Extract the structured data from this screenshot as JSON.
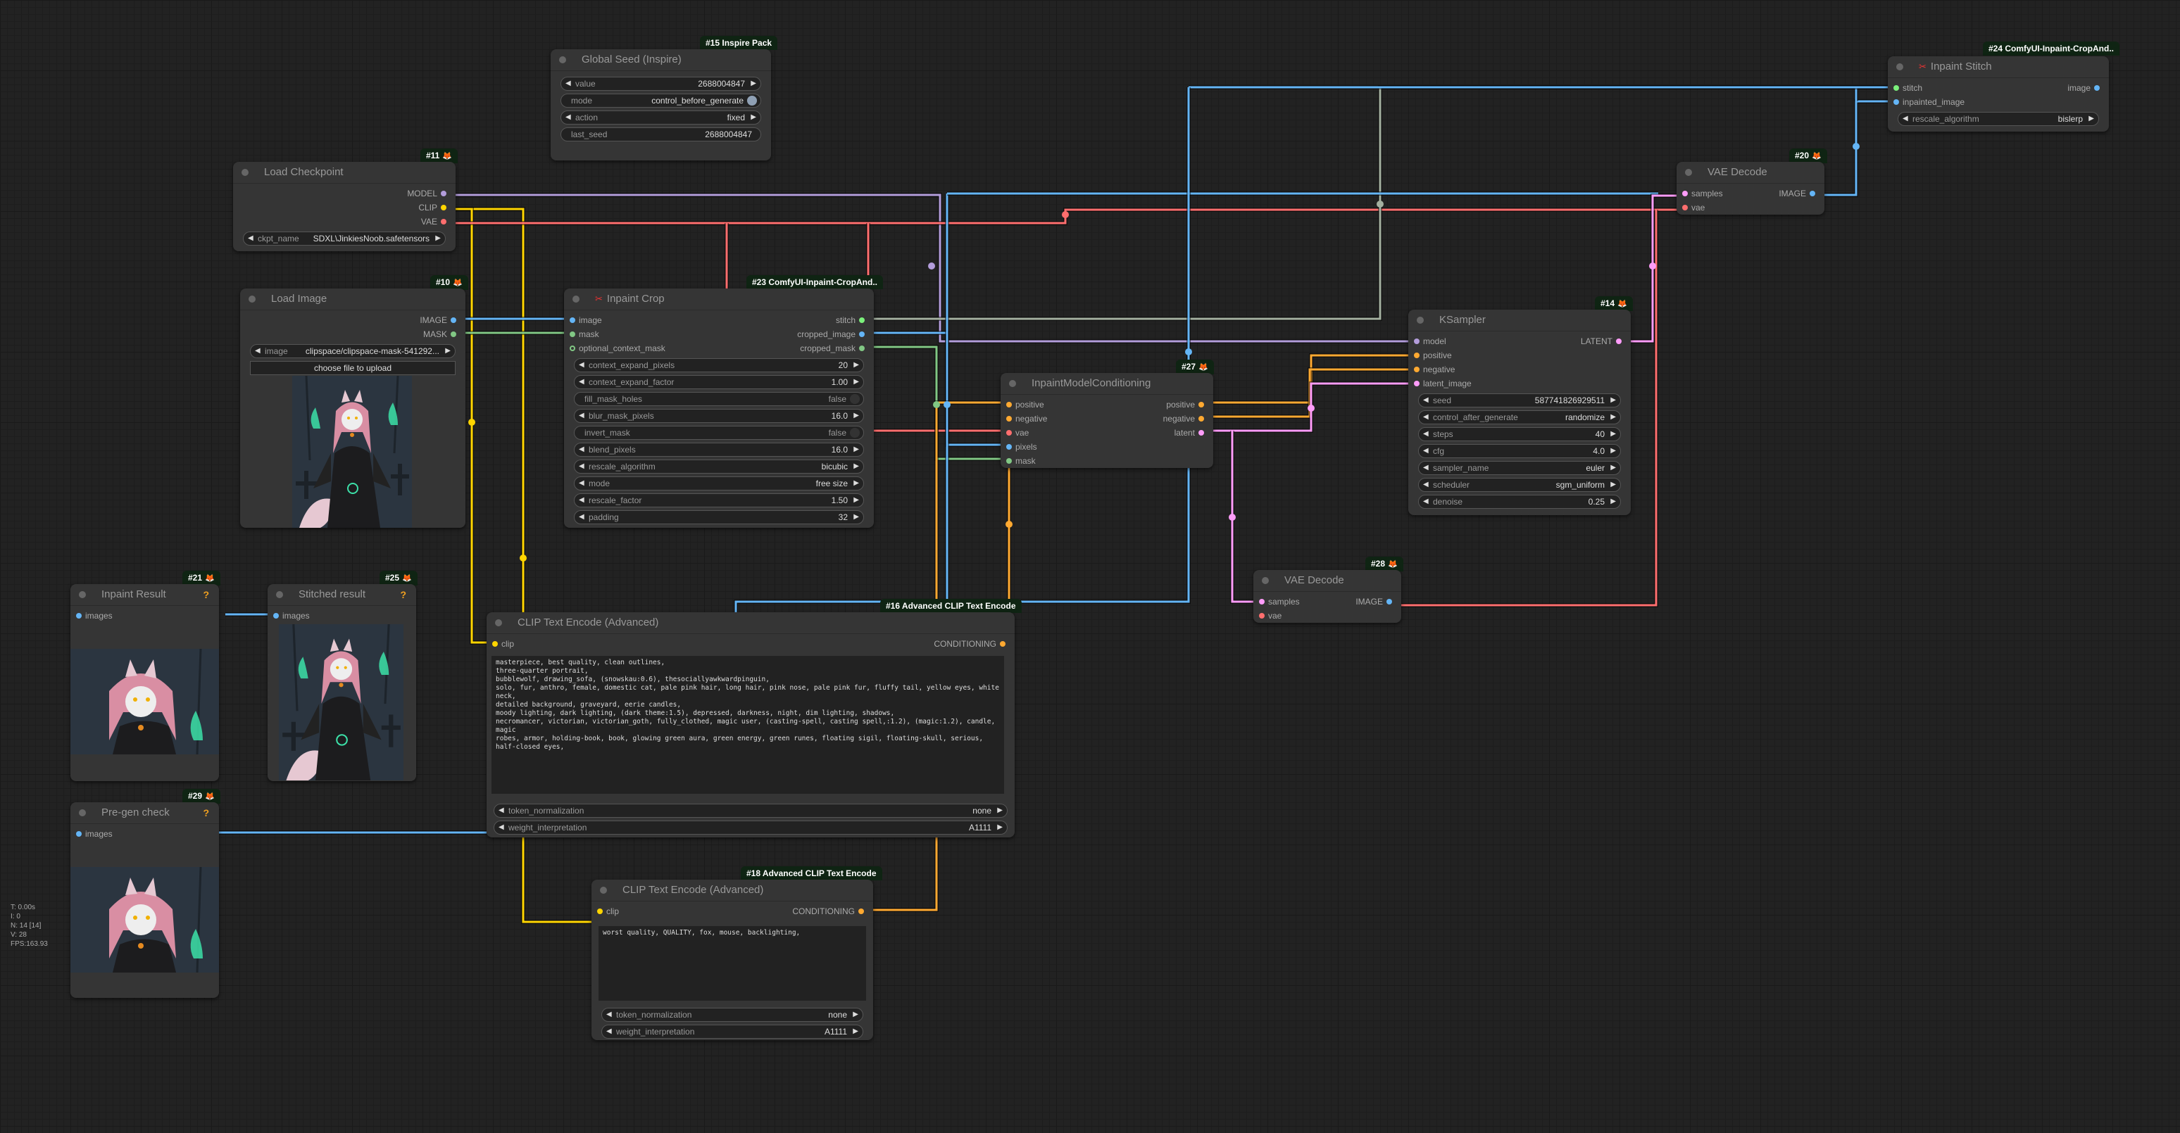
{
  "colors": {
    "model": "#b39ddb",
    "clip": "#ffd500",
    "vae": "#ff6e6e",
    "image": "#64b5f6",
    "mask": "#81c784",
    "conditioning": "#ffa931",
    "latent": "#ff9cf9",
    "stitch": "#7bf07b",
    "stitch_wire": "#a4b0a0",
    "badge_bg": "#0f2413"
  },
  "nodes": {
    "global_seed": {
      "badge": "#15 Inspire Pack",
      "title": "Global Seed (Inspire)",
      "widgets": [
        {
          "label": "value",
          "value": "2688004847"
        },
        {
          "label": "mode",
          "value": "control_before_generate"
        },
        {
          "label": "action",
          "value": "fixed"
        },
        {
          "label": "last_seed",
          "value": "2688004847"
        }
      ]
    },
    "load_checkpoint": {
      "badge": "#11",
      "title": "Load Checkpoint",
      "outputs": [
        "MODEL",
        "CLIP",
        "VAE"
      ],
      "widgets": [
        {
          "label": "ckpt_name",
          "value": "SDXL\\JinkiesNoob.safetensors"
        }
      ]
    },
    "load_image": {
      "badge": "#10",
      "title": "Load Image",
      "outputs": [
        "IMAGE",
        "MASK"
      ],
      "widgets": [
        {
          "label": "image",
          "value": "clipspace/clipspace-mask-541292..."
        }
      ],
      "upload_label": "choose file to upload"
    },
    "inpaint_crop": {
      "badge": "#23 ComfyUI-Inpaint-CropAnd..",
      "title": "Inpaint Crop",
      "inputs": [
        "image",
        "mask",
        "optional_context_mask"
      ],
      "outputs": [
        "stitch",
        "cropped_image",
        "cropped_mask"
      ],
      "widgets": [
        {
          "label": "context_expand_pixels",
          "value": "20"
        },
        {
          "label": "context_expand_factor",
          "value": "1.00"
        },
        {
          "label": "fill_mask_holes",
          "value": "false"
        },
        {
          "label": "blur_mask_pixels",
          "value": "16.0"
        },
        {
          "label": "invert_mask",
          "value": "false"
        },
        {
          "label": "blend_pixels",
          "value": "16.0"
        },
        {
          "label": "rescale_algorithm",
          "value": "bicubic"
        },
        {
          "label": "mode",
          "value": "free size"
        },
        {
          "label": "rescale_factor",
          "value": "1.50"
        },
        {
          "label": "padding",
          "value": "32"
        }
      ]
    },
    "inpaint_model_conditioning": {
      "badge": "#27",
      "title": "InpaintModelConditioning",
      "inputs": [
        "positive",
        "negative",
        "vae",
        "pixels",
        "mask"
      ],
      "outputs": [
        "positive",
        "negative",
        "latent"
      ]
    },
    "ksampler": {
      "badge": "#14",
      "title": "KSampler",
      "inputs": [
        "model",
        "positive",
        "negative",
        "latent_image"
      ],
      "outputs": [
        "LATENT"
      ],
      "widgets": [
        {
          "label": "seed",
          "value": "587741826929511"
        },
        {
          "label": "control_after_generate",
          "value": "randomize"
        },
        {
          "label": "steps",
          "value": "40"
        },
        {
          "label": "cfg",
          "value": "4.0"
        },
        {
          "label": "sampler_name",
          "value": "euler"
        },
        {
          "label": "scheduler",
          "value": "sgm_uniform"
        },
        {
          "label": "denoise",
          "value": "0.25"
        }
      ]
    },
    "vae_decode_20": {
      "badge": "#20",
      "title": "VAE Decode",
      "inputs": [
        "samples",
        "vae"
      ],
      "outputs": [
        "IMAGE"
      ]
    },
    "inpaint_stitch": {
      "badge": "#24 ComfyUI-Inpaint-CropAnd..",
      "title": "Inpaint Stitch",
      "inputs": [
        "stitch",
        "inpainted_image"
      ],
      "outputs": [
        "image"
      ],
      "widgets": [
        {
          "label": "rescale_algorithm",
          "value": "bislerp"
        }
      ]
    },
    "vae_decode_28": {
      "badge": "#28",
      "title": "VAE Decode",
      "inputs": [
        "samples",
        "vae"
      ],
      "outputs": [
        "IMAGE"
      ]
    },
    "inpaint_result": {
      "badge": "#21",
      "title": "Inpaint Result",
      "inputs": [
        "images"
      ],
      "help": "?"
    },
    "stitched_result": {
      "badge": "#25",
      "title": "Stitched result",
      "inputs": [
        "images"
      ],
      "help": "?"
    },
    "pre_gen_check": {
      "badge": "#29",
      "title": "Pre-gen check",
      "inputs": [
        "images"
      ],
      "help": "?"
    },
    "clip_positive": {
      "badge": "#16 Advanced CLIP Text Encode",
      "title": "CLIP Text Encode (Advanced)",
      "inputs": [
        "clip"
      ],
      "outputs": [
        "CONDITIONING"
      ],
      "text": "masterpiece, best quality, clean outlines,\nthree-quarter portrait,\nbubblewolf, drawing_sofa, (snowskau:0.6), thesociallyawkwardpinguin,\nsolo, fur, anthro, female, domestic cat, pale pink hair, long hair, pink nose, pale pink fur, fluffy tail, yellow eyes, white neck,\ndetailed background, graveyard, eerie candles,\nmoody lighting, dark lighting, (dark theme:1.5), depressed, darkness, night, dim lighting, shadows,\nnecromancer, victorian, victorian_goth, fully_clothed, magic user, (casting-spell, casting spell,:1.2), (magic:1.2), candle, magic\nrobes, armor, holding-book, book, glowing green aura, green energy, green runes, floating sigil, floating-skull, serious,\nhalf-closed eyes,",
      "widgets": [
        {
          "label": "token_normalization",
          "value": "none"
        },
        {
          "label": "weight_interpretation",
          "value": "A1111"
        }
      ]
    },
    "clip_negative": {
      "badge": "#18 Advanced CLIP Text Encode",
      "title": "CLIP Text Encode (Advanced)",
      "inputs": [
        "clip"
      ],
      "outputs": [
        "CONDITIONING"
      ],
      "text": "worst quality, QUALITY, fox, mouse, backlighting,",
      "widgets": [
        {
          "label": "token_normalization",
          "value": "none"
        },
        {
          "label": "weight_interpretation",
          "value": "A1111"
        }
      ]
    }
  },
  "stats": {
    "t": "T: 0.00s",
    "i": "I: 0",
    "n": "N: 14 [14]",
    "v": "V: 28",
    "fps": "FPS:163.93"
  },
  "icons": {
    "fox": "🦊",
    "scissors": "✂",
    "arrow_left": "◀",
    "arrow_right": "▶"
  }
}
